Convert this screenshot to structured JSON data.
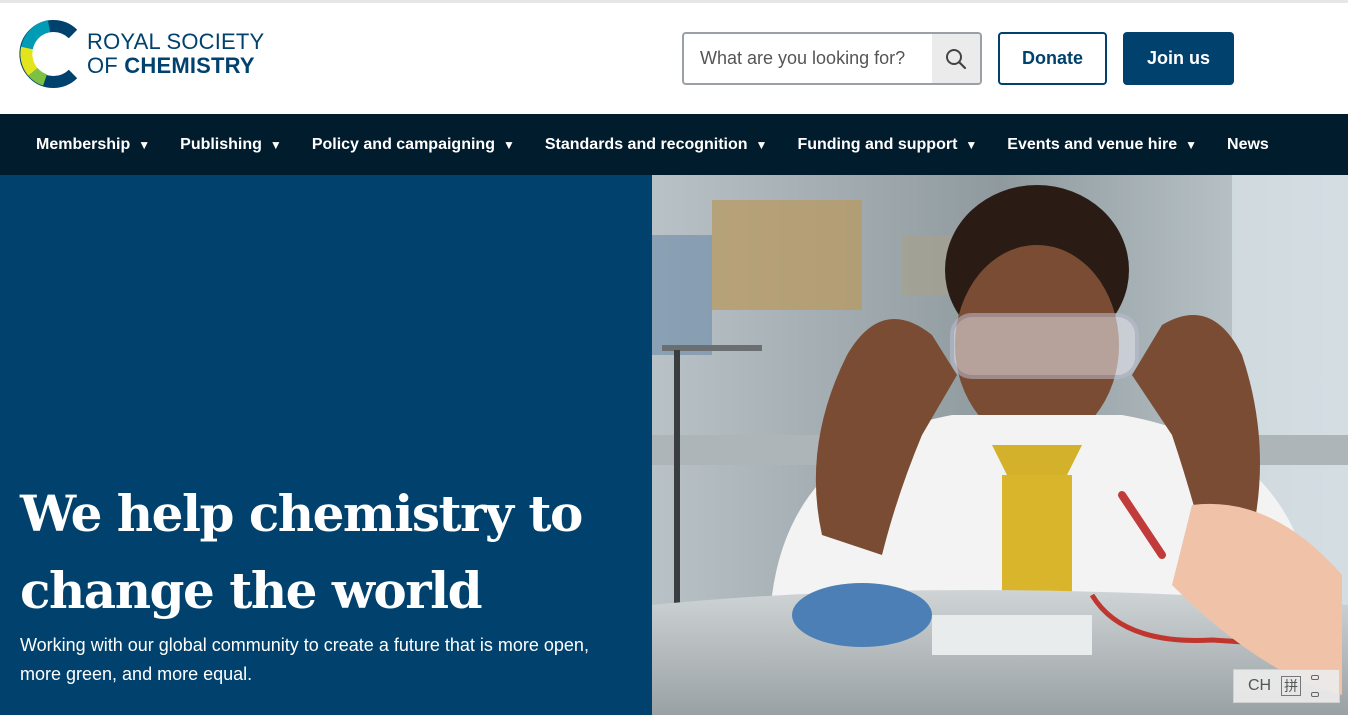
{
  "brand": {
    "line1": "ROYAL SOCIETY",
    "line2_prefix": "OF ",
    "line2_bold": "CHEMISTRY",
    "colors": {
      "navy": "#00426d",
      "teal": "#009bb4",
      "green": "#7bc143",
      "yellow": "#e2e41d",
      "nav_bg": "#011c2d"
    }
  },
  "header": {
    "search_placeholder": "What are you looking for?",
    "search_icon": "search-icon",
    "donate_label": "Donate",
    "join_label": "Join us"
  },
  "nav": {
    "items": [
      {
        "label": "Membership",
        "caret": "▼"
      },
      {
        "label": "Publishing",
        "caret": "▼"
      },
      {
        "label": "Policy and campaigning",
        "caret": "▼"
      },
      {
        "label": "Standards and recognition",
        "caret": "▼"
      },
      {
        "label": "Funding and support",
        "caret": "▼"
      },
      {
        "label": "Events and venue hire",
        "caret": "▼"
      },
      {
        "label": "News",
        "caret": ""
      }
    ]
  },
  "hero": {
    "title": "We help chemistry to change the world",
    "subtitle": "Working with our global community to create a future that is more open, more green, and more equal.",
    "image": "girl-wearing-safety-goggles-in-lab-photo"
  },
  "ime": {
    "mode": "CH",
    "pin": "拼"
  }
}
